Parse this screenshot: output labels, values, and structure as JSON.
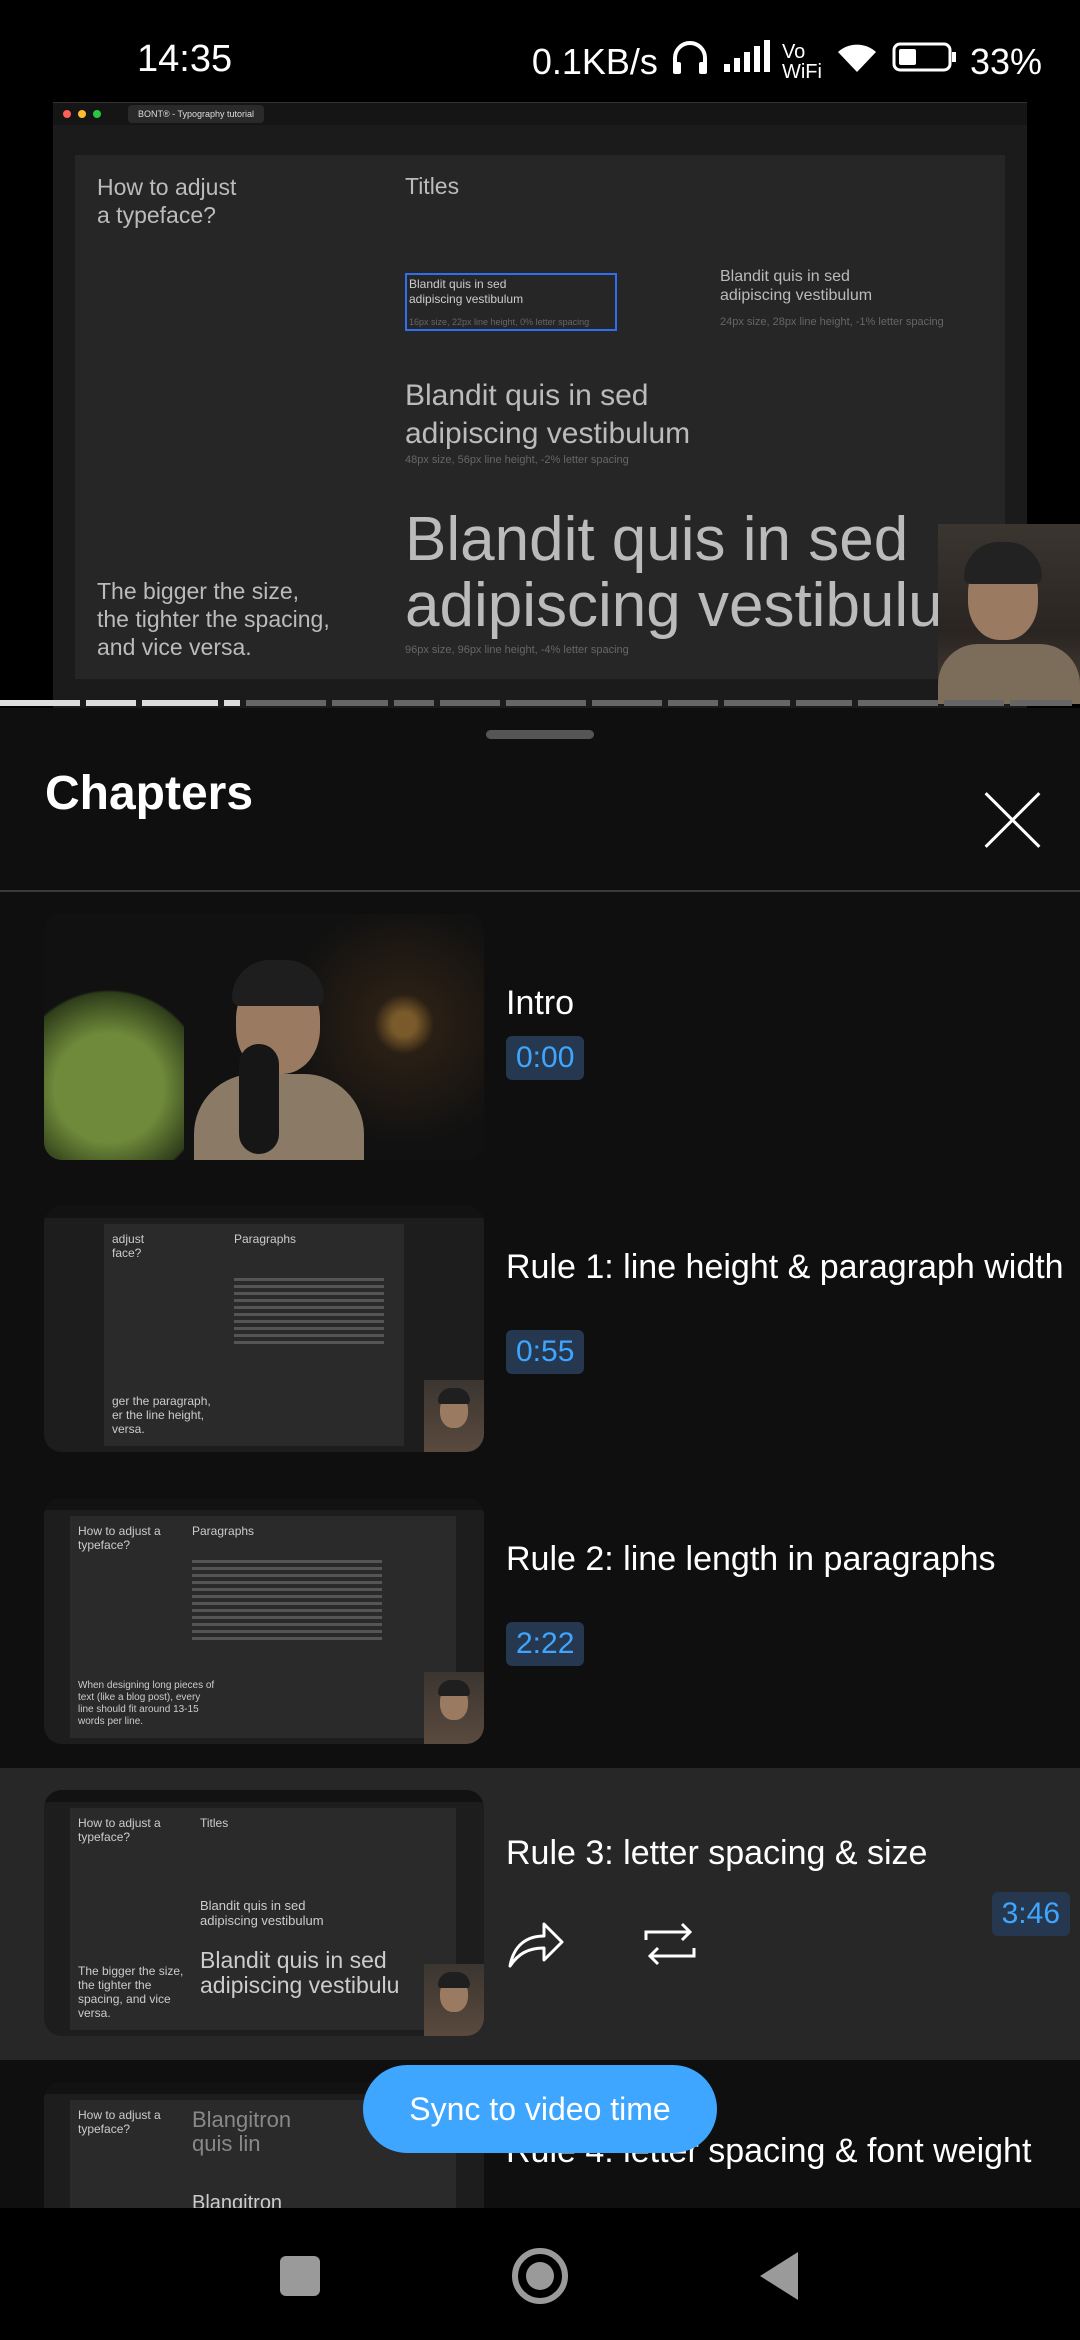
{
  "status_bar": {
    "time": "14:35",
    "network_speed": "0.1KB/s",
    "vowifi": "Vo WiFi",
    "battery_percent": "33%"
  },
  "video": {
    "browser_tab": "BONT® - Typography tutorial",
    "slide": {
      "question_line1": "How to adjust",
      "question_line2": "a typeface?",
      "titles_label": "Titles",
      "sample_small_line1": "Blandit quis in sed",
      "sample_small_line2": "adipiscing vestibulum",
      "sample_small_meta": "16px size, 22px line height, 0% letter spacing",
      "sample_24_line1": "Blandit quis in sed",
      "sample_24_line2": "adipiscing vestibulum",
      "sample_24_meta": "24px size, 28px line height, -1% letter spacing",
      "sample_48_line1": "Blandit quis in sed",
      "sample_48_line2": "adipiscing vestibulum",
      "sample_48_meta": "48px size, 56px line height, -2% letter spacing",
      "sample_96_line1": "Blandit quis in sed",
      "sample_96_line2": "adipiscing vestibulu",
      "sample_96_meta": "96px size, 96px line height, -4% letter spacing",
      "note_line1": "The bigger the size,",
      "note_line2": "the tighter the spacing,",
      "note_line3": "and vice versa."
    }
  },
  "panel": {
    "title": "Chapters",
    "sync_button": "Sync to video time",
    "chapters": [
      {
        "title": "Intro",
        "time": "0:00"
      },
      {
        "title": "Rule 1: line height & paragraph width",
        "time": "0:55",
        "thumb_heading": "Paragraphs",
        "thumb_note": "ger the paragraph, er the line height, versa.",
        "thumb_q": "adjust face?"
      },
      {
        "title": "Rule 2: line length in paragraphs",
        "time": "2:22",
        "thumb_heading": "Paragraphs",
        "thumb_q": "How to adjust a typeface?",
        "thumb_note": "When designing long pieces of text (like a blog post), every line should fit around 13-15 words per line."
      },
      {
        "title": "Rule 3: letter spacing & size",
        "time": "3:46",
        "thumb_heading": "Titles",
        "thumb_q": "How to adjust a typeface?",
        "thumb_note": "The bigger the size, the tighter the spacing, and vice versa.",
        "thumb_mid": "Blandit quis in sed adipiscing vestibulum",
        "thumb_big": "Blandit quis in sed adipiscing vestibulu"
      },
      {
        "title": "Rule 4: letter spacing & font weight",
        "time": "",
        "thumb_q": "How to adjust a typeface?",
        "thumb_heading": "Blangitron quis lin",
        "thumb_mid": "Blangitron quis lin"
      }
    ]
  },
  "colors": {
    "accent": "#3ea6ff",
    "active_row": "#272727",
    "time_badge_bg": "#263850"
  }
}
